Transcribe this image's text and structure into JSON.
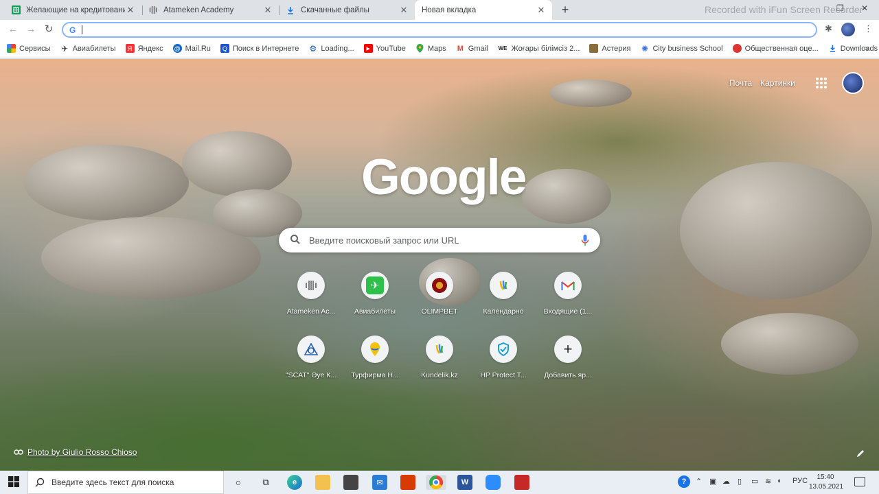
{
  "tabs": [
    {
      "title": "Желающие на кредитование Ф",
      "icon": "sheets-icon"
    },
    {
      "title": "Atameken Academy",
      "icon": "atameken-icon"
    },
    {
      "title": "Скачанные файлы",
      "icon": "download-icon"
    },
    {
      "title": "Новая вкладка",
      "icon": "",
      "active": true
    }
  ],
  "watermark": "Recorded with iFun Screen Recorder",
  "omnibox": {
    "value": "",
    "placeholder": ""
  },
  "bookmarks": [
    {
      "label": "Сервисы",
      "icon": "apps-icon"
    },
    {
      "label": "Авиабилеты",
      "icon": "plane-icon"
    },
    {
      "label": "Яндекс",
      "icon": "yandex-icon"
    },
    {
      "label": "Mail.Ru",
      "icon": "mailru-icon"
    },
    {
      "label": "Поиск в Интернете",
      "icon": "search-icon"
    },
    {
      "label": "Loading...",
      "icon": "gear-icon"
    },
    {
      "label": "YouTube",
      "icon": "youtube-icon"
    },
    {
      "label": "Maps",
      "icon": "maps-icon"
    },
    {
      "label": "Gmail",
      "icon": "gmail-icon"
    },
    {
      "label": "Жоғары білімсіз 2...",
      "icon": "we-icon"
    },
    {
      "label": "Астерия",
      "icon": "asteria-icon"
    },
    {
      "label": "City business School",
      "icon": "city-icon"
    },
    {
      "label": "Общественная оце...",
      "icon": "public-icon"
    },
    {
      "label": "Downloads",
      "icon": "download-icon"
    }
  ],
  "ntp": {
    "mail_link": "Почта",
    "images_link": "Картинки",
    "logo": "Google",
    "search_placeholder": "Введите поисковый запрос или URL",
    "shortcuts": [
      {
        "label": "Atameken Ac...",
        "icon": "atameken-icon"
      },
      {
        "label": "Авиабилеты",
        "icon": "plane-icon"
      },
      {
        "label": "OLIMPBET",
        "icon": "olimpbet-icon"
      },
      {
        "label": "Календарно",
        "icon": "kundelik-icon"
      },
      {
        "label": "Входящие (1...",
        "icon": "gmail-icon"
      },
      {
        "label": "\"SCAT\" Әуе К...",
        "icon": "scat-icon"
      },
      {
        "label": "Турфирма Н...",
        "icon": "pin-icon"
      },
      {
        "label": "Kundelik.kz",
        "icon": "kundelik-icon"
      },
      {
        "label": "HP Protect T...",
        "icon": "hp-icon"
      },
      {
        "label": "Добавить яр...",
        "icon": "plus-icon"
      }
    ],
    "photo_credit": "Photo by Giulio Rosso Chioso"
  },
  "taskbar": {
    "search_placeholder": "Введите здесь текст для поиска",
    "language": "РУС",
    "time": "15:40",
    "date": "13.05.2021"
  },
  "colors": {
    "accent": "#1a73e8",
    "tab_strip": "#dee1e6"
  }
}
